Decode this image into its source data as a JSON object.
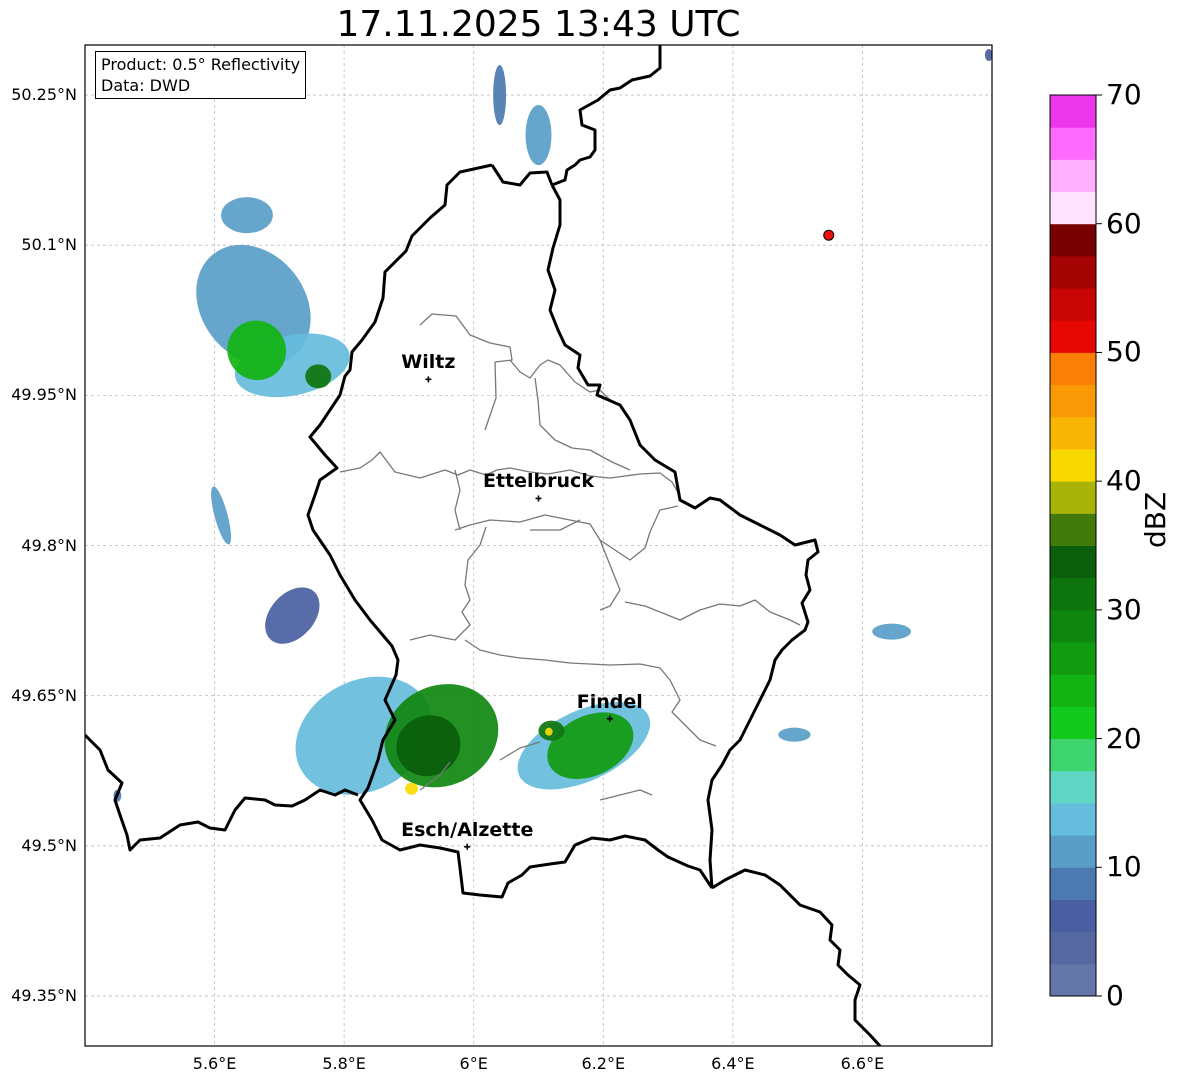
{
  "title": "17.11.2025 13:43 UTC",
  "info_box": {
    "line1": "Product: 0.5° Reflectivity",
    "line2": "Data: DWD"
  },
  "map_extent": {
    "lon_min": 5.4,
    "lon_max": 6.8,
    "lat_min": 49.3,
    "lat_max": 50.3
  },
  "lat_ticks": [
    {
      "value": 50.25,
      "label": "50.25°N"
    },
    {
      "value": 50.1,
      "label": "50.1°N"
    },
    {
      "value": 49.95,
      "label": "49.95°N"
    },
    {
      "value": 49.8,
      "label": "49.8°N"
    },
    {
      "value": 49.65,
      "label": "49.65°N"
    },
    {
      "value": 49.5,
      "label": "49.5°N"
    },
    {
      "value": 49.35,
      "label": "49.35°N"
    }
  ],
  "lon_ticks": [
    {
      "value": 5.6,
      "label": "5.6°E"
    },
    {
      "value": 5.8,
      "label": "5.8°E"
    },
    {
      "value": 6.0,
      "label": "6°E"
    },
    {
      "value": 6.2,
      "label": "6.2°E"
    },
    {
      "value": 6.4,
      "label": "6.4°E"
    },
    {
      "value": 6.6,
      "label": "6.6°E"
    }
  ],
  "cities": [
    {
      "name": "Wiltz",
      "lon": 5.93,
      "lat": 49.966
    },
    {
      "name": "Ettelbruck",
      "lon": 6.1,
      "lat": 49.847
    },
    {
      "name": "Findel",
      "lon": 6.21,
      "lat": 49.627
    },
    {
      "name": "Esch/Alzette",
      "lon": 5.99,
      "lat": 49.499
    }
  ],
  "radar_site": {
    "lon": 6.548,
    "lat": 50.11,
    "color": "#ee1111"
  },
  "colorbar": {
    "label": "dBZ",
    "min": 0,
    "max": 70,
    "ticks": [
      "0",
      "10",
      "20",
      "30",
      "40",
      "50",
      "60",
      "70"
    ],
    "colors": [
      "#6475a8",
      "#5568a0",
      "#4a5fa2",
      "#4b79b0",
      "#5a9ec8",
      "#65bcdc",
      "#5fd6c4",
      "#3ed46e",
      "#13c91e",
      "#12b312",
      "#119b11",
      "#0f870f",
      "#0e750e",
      "#0b5e0b",
      "#437a0c",
      "#a9b409",
      "#f7d900",
      "#f8b503",
      "#f89905",
      "#f97f05",
      "#e60703",
      "#c90505",
      "#a30303",
      "#780101",
      "#ffe2ff",
      "#ffb0ff",
      "#ff6bff",
      "#eb36eb"
    ]
  },
  "precip_cells": [
    {
      "lon": 5.66,
      "lat": 50.04,
      "rx": 0.08,
      "ry": 0.065,
      "rot": -38,
      "dbz": 11
    },
    {
      "lon": 5.72,
      "lat": 49.98,
      "rx": 0.09,
      "ry": 0.03,
      "rot": -12,
      "dbz": 13
    },
    {
      "lon": 5.665,
      "lat": 49.995,
      "rx": 0.045,
      "ry": 0.03,
      "rot": -30,
      "dbz": 24
    },
    {
      "lon": 5.76,
      "lat": 49.969,
      "rx": 0.02,
      "ry": 0.012,
      "rot": 0,
      "dbz": 30
    },
    {
      "lon": 5.65,
      "lat": 50.13,
      "rx": 0.04,
      "ry": 0.018,
      "rot": 0,
      "dbz": 12
    },
    {
      "lon": 5.72,
      "lat": 49.73,
      "rx": 0.05,
      "ry": 0.022,
      "rot": -48,
      "dbz": 7
    },
    {
      "lon": 5.83,
      "lat": 49.61,
      "rx": 0.11,
      "ry": 0.055,
      "rot": -28,
      "dbz": 13
    },
    {
      "lon": 5.95,
      "lat": 49.61,
      "rx": 0.09,
      "ry": 0.05,
      "rot": -25,
      "dbz": 28
    },
    {
      "lon": 5.93,
      "lat": 49.6,
      "rx": 0.05,
      "ry": 0.03,
      "rot": -25,
      "dbz": 33
    },
    {
      "lon": 6.17,
      "lat": 49.6,
      "rx": 0.11,
      "ry": 0.035,
      "rot": -25,
      "dbz": 14
    },
    {
      "lon": 6.18,
      "lat": 49.6,
      "rx": 0.07,
      "ry": 0.03,
      "rot": -25,
      "dbz": 25
    },
    {
      "lon": 6.12,
      "lat": 49.615,
      "rx": 0.02,
      "ry": 0.01,
      "rot": 0,
      "dbz": 30
    },
    {
      "lon": 5.904,
      "lat": 49.557,
      "rx": 0.01,
      "ry": 0.006,
      "rot": 0,
      "dbz": 40
    },
    {
      "lon": 6.116,
      "lat": 49.614,
      "rx": 0.006,
      "ry": 0.004,
      "rot": 0,
      "dbz": 41
    },
    {
      "lon": 6.645,
      "lat": 49.714,
      "rx": 0.03,
      "ry": 0.008,
      "rot": 0,
      "dbz": 10
    },
    {
      "lon": 6.495,
      "lat": 49.611,
      "rx": 0.025,
      "ry": 0.007,
      "rot": 0,
      "dbz": 10
    },
    {
      "lon": 5.61,
      "lat": 49.83,
      "rx": 0.01,
      "ry": 0.03,
      "rot": -15,
      "dbz": 12
    },
    {
      "lon": 6.1,
      "lat": 50.21,
      "rx": 0.02,
      "ry": 0.03,
      "rot": 0,
      "dbz": 11
    },
    {
      "lon": 6.04,
      "lat": 50.25,
      "rx": 0.01,
      "ry": 0.03,
      "rot": 0,
      "dbz": 8
    },
    {
      "lon": 5.45,
      "lat": 49.55,
      "rx": 0.006,
      "ry": 0.006,
      "rot": 0,
      "dbz": 8
    },
    {
      "lon": 6.795,
      "lat": 50.29,
      "rx": 0.006,
      "ry": 0.006,
      "rot": 0,
      "dbz": 7
    }
  ]
}
